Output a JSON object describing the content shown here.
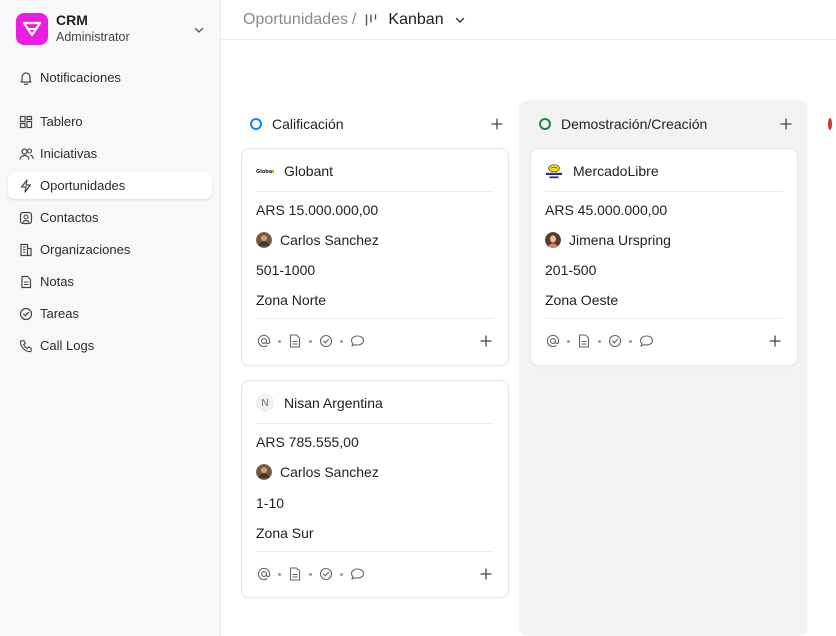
{
  "sidebar": {
    "brand": {
      "name": "CRM",
      "role": "Administrator"
    },
    "items": [
      {
        "label": "Notificaciones",
        "icon": "bell-icon",
        "active": false
      },
      {
        "label": "Tablero",
        "icon": "dashboard-icon",
        "active": false
      },
      {
        "label": "Iniciativas",
        "icon": "users-icon",
        "active": false
      },
      {
        "label": "Oportunidades",
        "icon": "lightning-icon",
        "active": true
      },
      {
        "label": "Contactos",
        "icon": "contact-icon",
        "active": false
      },
      {
        "label": "Organizaciones",
        "icon": "building-icon",
        "active": false
      },
      {
        "label": "Notas",
        "icon": "note-icon",
        "active": false
      },
      {
        "label": "Tareas",
        "icon": "check-circle-icon",
        "active": false
      },
      {
        "label": "Call Logs",
        "icon": "phone-icon",
        "active": false
      }
    ]
  },
  "header": {
    "breadcrumb": "Oportunidades",
    "separator": "/",
    "view": "Kanban"
  },
  "columns": [
    {
      "title": "Calificación",
      "status_color": "#0a84ff",
      "cards": [
        {
          "org": "Globant",
          "logo_text": "Globant",
          "amount": "ARS 15.000.000,00",
          "owner": "Carlos Sanchez",
          "size": "501-1000",
          "zone": "Zona Norte"
        },
        {
          "org": "Nisan Argentina",
          "logo_text": "N",
          "amount": "ARS 785.555,00",
          "owner": "Carlos Sanchez",
          "size": "1-10",
          "zone": "Zona Sur"
        }
      ]
    },
    {
      "title": "Demostración/Creación",
      "status_color": "#128a3e",
      "cards": [
        {
          "org": "MercadoLibre",
          "logo_text": "mercado libre",
          "amount": "ARS 45.000.000,00",
          "owner": "Jimena Urspring",
          "size": "201-500",
          "zone": "Zona Oeste"
        }
      ]
    },
    {
      "title": "",
      "status_color": "#e0302b",
      "cards": []
    }
  ],
  "colors": {
    "brand": "#e91ee0",
    "active_bg": "#ffffff",
    "column_bg": "#f3f3f3"
  }
}
